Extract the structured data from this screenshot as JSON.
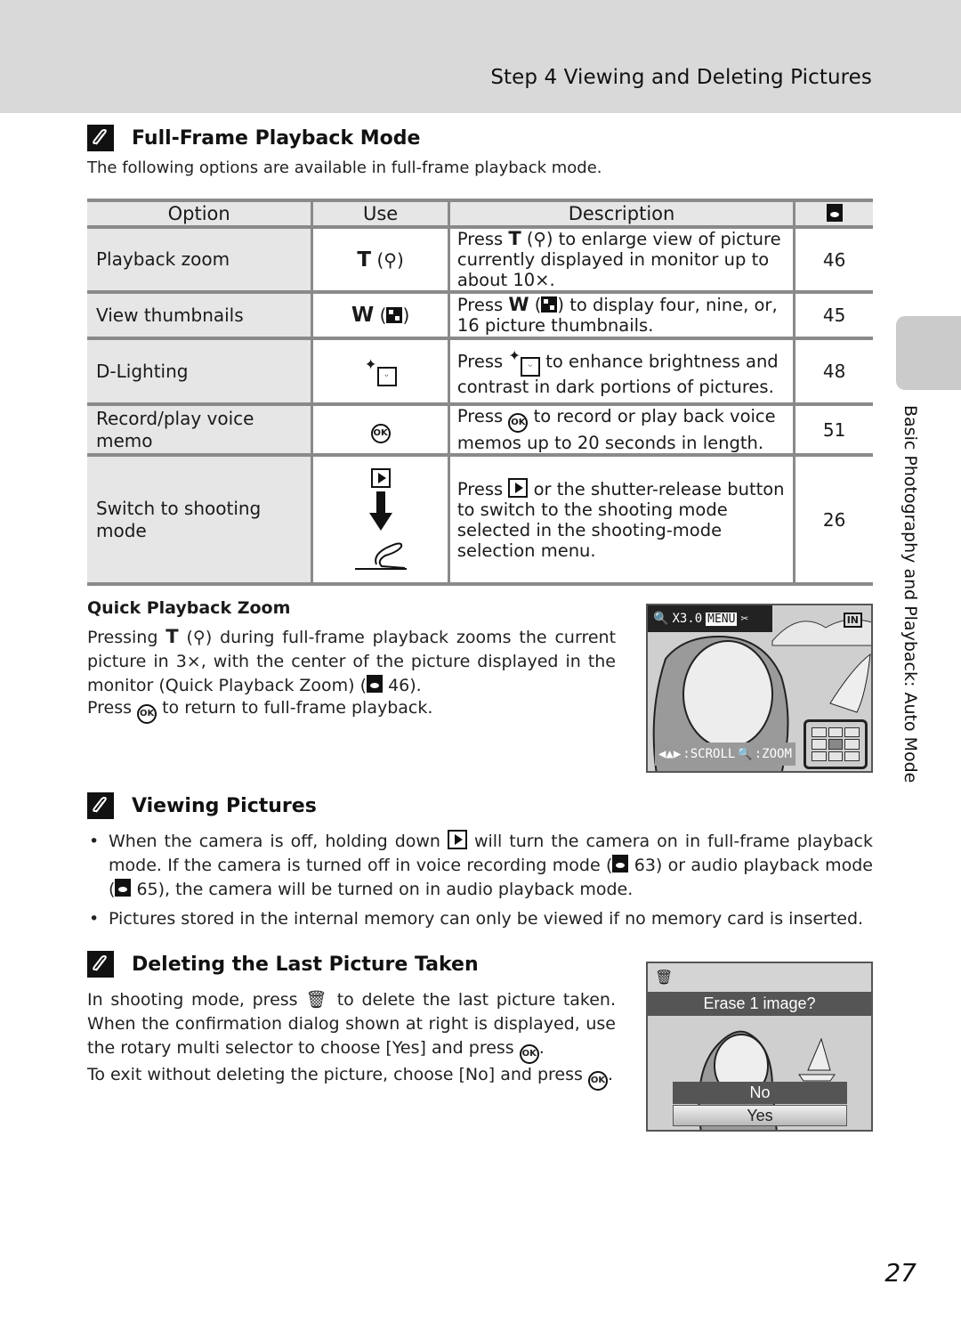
{
  "header": {
    "title": "Step 4 Viewing and Deleting Pictures"
  },
  "sections": {
    "full_frame": {
      "heading": "Full-Frame Playback Mode",
      "intro": "The following options are available in full-frame playback mode.",
      "table": {
        "headers": {
          "option": "Option",
          "use": "Use",
          "description": "Description",
          "page_icon": "reference-icon"
        },
        "rows": [
          {
            "option": "Playback zoom",
            "use": "T (zoom-in-icon)",
            "use_key": "T",
            "use_paren": "(",
            "use_close": ")",
            "description_pre": "Press",
            "description": "to enlarge view of picture currently displayed in monitor up to about 10×.",
            "page": "46"
          },
          {
            "option": "View thumbnails",
            "use": "W (thumbnail-icon)",
            "use_key": "W",
            "description_pre": "Press",
            "description": "to display four, nine, or, 16 picture thumbnails.",
            "page": "45"
          },
          {
            "option": "D-Lighting",
            "use": "d-lighting-icon",
            "description_pre": "Press",
            "description": "to enhance brightness and contrast in dark portions of pictures.",
            "page": "48"
          },
          {
            "option": "Record/play voice memo",
            "use": "ok-button-icon",
            "description_pre": "Press",
            "description": "to record or play back voice memos up to 20 seconds in length.",
            "page": "51"
          },
          {
            "option": "Switch to shooting mode",
            "use": "playback-button / shutter-release",
            "description_pre": "Press",
            "description": "or the shutter-release button to switch to the shooting mode selected in the shooting-mode selection menu.",
            "page": "26"
          }
        ]
      }
    },
    "quick_zoom": {
      "title": "Quick Playback Zoom",
      "body_pre": "Pressing",
      "body_key": "T",
      "body": "during full-frame playback zooms the current picture in 3×, with the center of the picture displayed in the monitor (Quick Playback Zoom) (",
      "body_ref": "46).",
      "body2_pre": "Press",
      "body2": "to return to full-frame playback.",
      "lcd": {
        "zoom_label": "X3.0",
        "menu_label": "MENU",
        "memory_label": "IN",
        "scroll_label": ":SCROLL",
        "zoom_hint": ":ZOOM"
      }
    },
    "viewing": {
      "heading": "Viewing Pictures",
      "bullets": [
        {
          "pre": "When the camera is off, holding down",
          "post": "will turn the camera on in full-frame playback mode. If the camera is turned off in voice recording mode (",
          "ref1": "63) or audio playback mode (",
          "ref2": "65), the camera will be turned on in audio playback mode."
        },
        {
          "text": "Pictures stored in the internal memory can only be viewed if no memory card is inserted."
        }
      ]
    },
    "deleting": {
      "heading": "Deleting the Last Picture Taken",
      "body_pre": "In shooting mode, press",
      "body": "to delete the last picture taken. When the confirmation dialog shown at right is displayed, use the rotary multi selector to choose [Yes] and press",
      "body_end": ".",
      "body2": "To exit without deleting the picture, choose [No] and press",
      "body2_end": ".",
      "lcd": {
        "prompt": "Erase 1 image?",
        "option_no": "No",
        "option_yes": "Yes"
      }
    }
  },
  "side_tab": {
    "label": "Basic Photography and Playback: Auto Mode"
  },
  "page_number": "27"
}
